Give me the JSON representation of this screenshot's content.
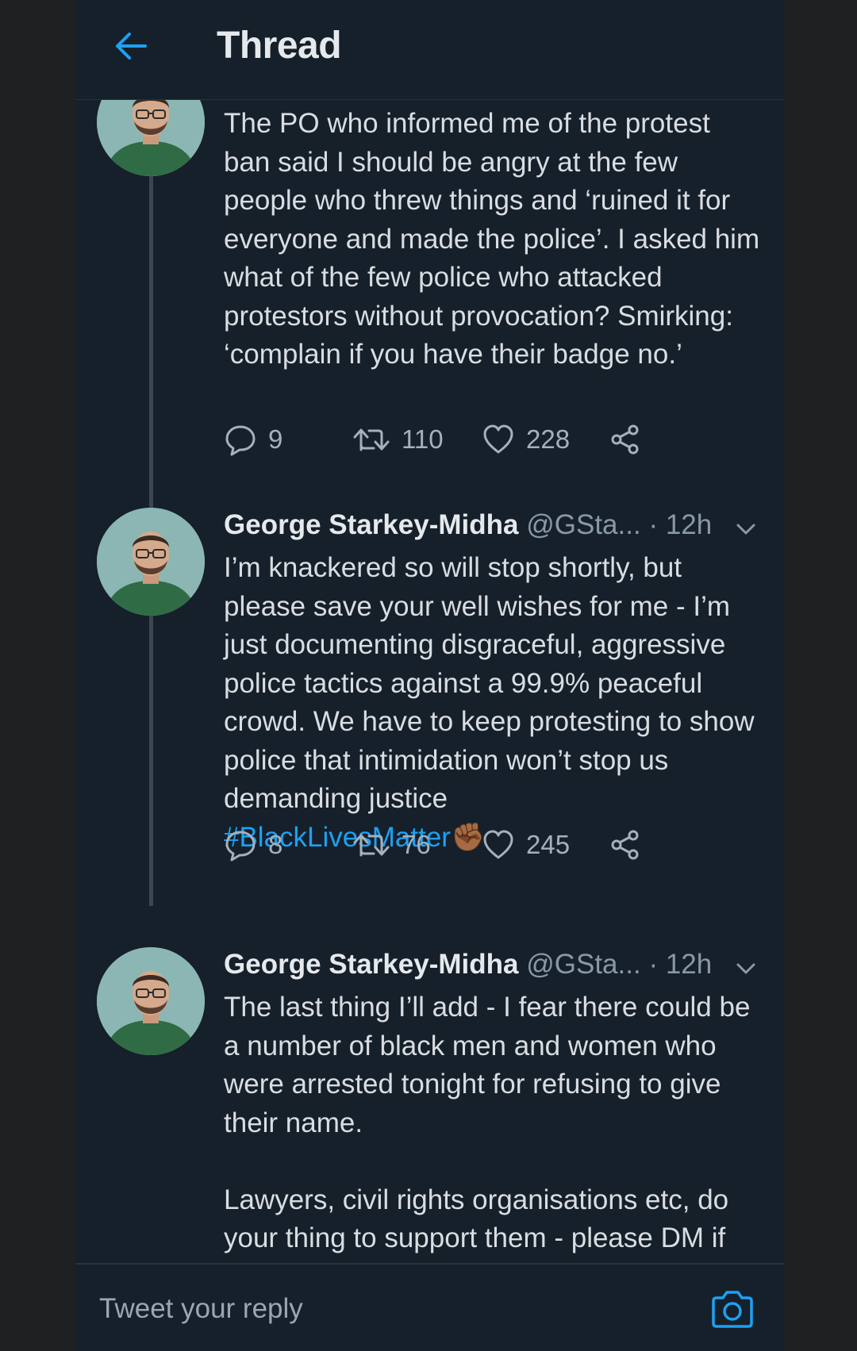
{
  "header": {
    "title": "Thread",
    "back_icon": "arrow-left-icon"
  },
  "colors": {
    "background": "#15202b",
    "accent": "#1da1f2",
    "text": "#d9dde1",
    "muted": "#8899a6"
  },
  "tweets": [
    {
      "text": "The PO who informed me of the protest ban said I should be angry at the few people who threw things and ‘ruined it for everyone and made the police’. I asked him what of the few police who attacked protestors without provocation? Smirking: ‘complain if you have their badge no.’",
      "replies": "9",
      "retweets": "110",
      "likes": "228"
    },
    {
      "author": "George Starkey-Midha",
      "handle": "@GSta...",
      "time": "· 12h",
      "text": "I’m knackered so will stop shortly, but please save your well wishes for me - I’m just documenting disgraceful, aggressive police tactics against a 99.9% peaceful crowd. We have to keep protesting to show police that intimidation won’t stop us demanding justice",
      "hashtag": "#BlackLivesMatter",
      "emoji": "✊🏾",
      "replies": "8",
      "retweets": "76",
      "likes": "245"
    },
    {
      "author": "George Starkey-Midha",
      "handle": "@GSta...",
      "time": "· 12h",
      "text": "The last thing I’ll add - I fear there could be a number of black men and women who were arrested tonight for refusing to give their name.\n\nLawyers, civil rights organisations etc, do your thing to support them - please DM if"
    }
  ],
  "reply_bar": {
    "placeholder": "Tweet your reply",
    "camera_icon": "camera-icon"
  }
}
